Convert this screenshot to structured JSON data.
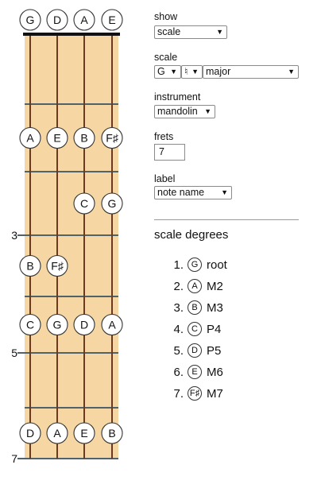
{
  "fretboard": {
    "open_notes": [
      "G",
      "D",
      "A",
      "E"
    ],
    "fret_labels": [
      {
        "fret": 3,
        "label": "3"
      },
      {
        "fret": 5,
        "label": "5"
      },
      {
        "fret": 7,
        "label": "7"
      }
    ],
    "notes": [
      {
        "fret": 2,
        "string": 0,
        "label": "A"
      },
      {
        "fret": 2,
        "string": 1,
        "label": "E"
      },
      {
        "fret": 2,
        "string": 2,
        "label": "B"
      },
      {
        "fret": 2,
        "string": 3,
        "label": "F♯"
      },
      {
        "fret": 3,
        "string": 2,
        "label": "C"
      },
      {
        "fret": 3,
        "string": 3,
        "label": "G"
      },
      {
        "fret": 4,
        "string": 0,
        "label": "B"
      },
      {
        "fret": 4,
        "string": 1,
        "label": "F♯"
      },
      {
        "fret": 5,
        "string": 0,
        "label": "C"
      },
      {
        "fret": 5,
        "string": 1,
        "label": "G"
      },
      {
        "fret": 5,
        "string": 2,
        "label": "D"
      },
      {
        "fret": 5,
        "string": 3,
        "label": "A"
      },
      {
        "fret": 7,
        "string": 0,
        "label": "D"
      },
      {
        "fret": 7,
        "string": 1,
        "label": "A"
      },
      {
        "fret": 7,
        "string": 2,
        "label": "E"
      },
      {
        "fret": 7,
        "string": 3,
        "label": "B"
      }
    ],
    "colors": {
      "wood": "#f6d7a3",
      "fret": "#50636c",
      "string": "#6b3a20",
      "nut": "#111111"
    }
  },
  "controls": {
    "show_label": "show",
    "show_value": "scale",
    "scale_label": "scale",
    "scale_root": "G",
    "scale_accidental": "♮",
    "scale_type": "major",
    "instrument_label": "instrument",
    "instrument_value": "mandolin",
    "frets_label": "frets",
    "frets_value": "7",
    "label_label": "label",
    "label_value": "note name"
  },
  "scale_degrees": {
    "title": "scale degrees",
    "items": [
      {
        "num": "1.",
        "note": "G",
        "interval": "root"
      },
      {
        "num": "2.",
        "note": "A",
        "interval": "M2"
      },
      {
        "num": "3.",
        "note": "B",
        "interval": "M3"
      },
      {
        "num": "4.",
        "note": "C",
        "interval": "P4"
      },
      {
        "num": "5.",
        "note": "D",
        "interval": "P5"
      },
      {
        "num": "6.",
        "note": "E",
        "interval": "M6"
      },
      {
        "num": "7.",
        "note": "F♯",
        "interval": "M7"
      }
    ]
  }
}
